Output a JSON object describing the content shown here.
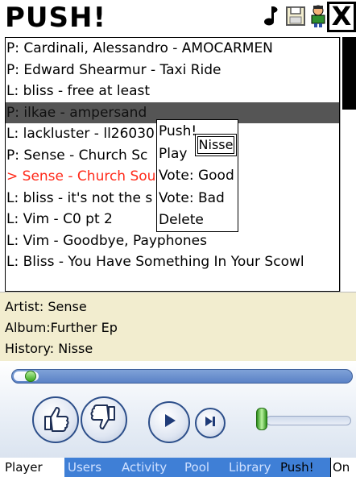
{
  "app": {
    "title": "PUSH!"
  },
  "titlebar": {
    "icons": [
      "music-note-icon",
      "save-icon",
      "user-icon"
    ],
    "close_label": "X"
  },
  "queue": {
    "items": [
      {
        "text": "P: Cardinali, Alessandro - AMOCARMEN",
        "state": "normal"
      },
      {
        "text": "P: Edward Shearmur - Taxi Ride",
        "state": "normal"
      },
      {
        "text": "L: bliss - free at least",
        "state": "normal"
      },
      {
        "text": "P: ilkae - ampersand",
        "state": "selected"
      },
      {
        "text": "L: lackluster - ll26030",
        "state": "normal"
      },
      {
        "text": "P: Sense - Church Sc",
        "state": "normal"
      },
      {
        "text": "> Sense - Church Sou",
        "state": "current"
      },
      {
        "text": "L: bliss - it's not the s",
        "state": "normal"
      },
      {
        "text": "L: Vim - C0 pt 2",
        "state": "normal"
      },
      {
        "text": "L: Vim - Goodbye, Payphones",
        "state": "normal"
      },
      {
        "text": "L: Bliss - You Have Something In Your Scowl",
        "state": "normal"
      }
    ]
  },
  "context_menu": {
    "items": [
      "Push!",
      "Play",
      "Vote: Good",
      "Vote: Bad",
      "Delete"
    ],
    "submenu_item": "Nisse"
  },
  "info": {
    "artist_label": "Artist:",
    "artist_value": "Sense",
    "album_label": "Album:",
    "album_value": "Further Ep",
    "history_label": "History:",
    "history_value": "Nisse"
  },
  "player": {
    "progress_fraction": 0.04,
    "volume_fraction": 0.0,
    "buttons": [
      "thumbs-up-icon",
      "thumbs-down-icon",
      "play-icon",
      "next-icon"
    ]
  },
  "tabs": {
    "items": [
      "Player",
      "Users",
      "Activity",
      "Pool",
      "Library",
      "Push!",
      "On"
    ],
    "active": "Player"
  },
  "colors": {
    "current_track": "#ff2a1a",
    "selected_row": "#555555",
    "info_bg": "#f2edcf",
    "tab_bar": "#3f7fd6"
  }
}
